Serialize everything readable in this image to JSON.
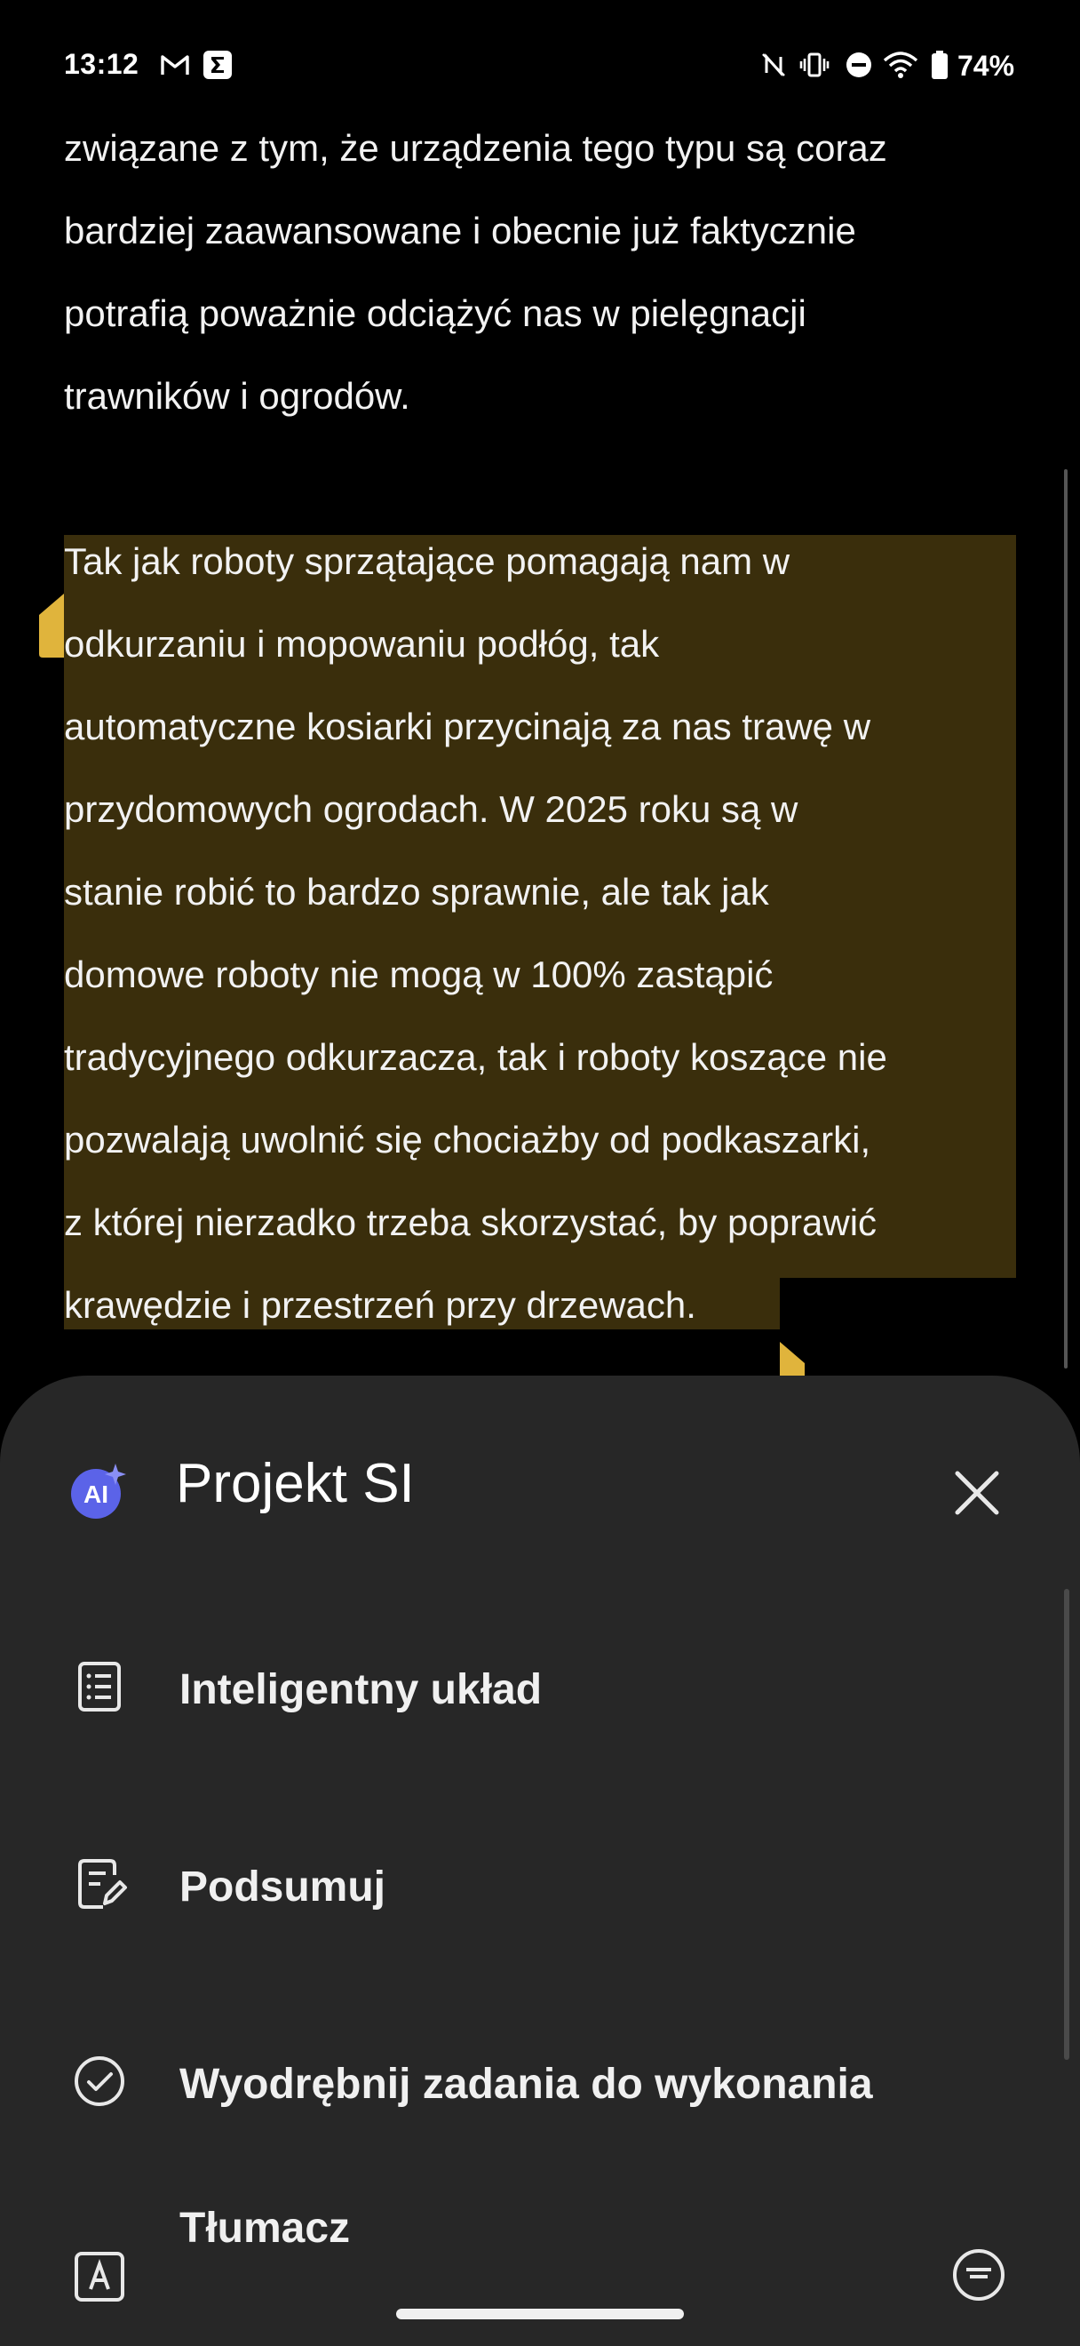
{
  "status": {
    "time": "13:12",
    "battery": "74%",
    "left_icons": [
      "gmail-icon",
      "sigma-app-icon"
    ],
    "right_icons": [
      "nfc-icon",
      "vibrate-icon",
      "do-not-disturb-icon",
      "wifi-icon",
      "battery-icon"
    ]
  },
  "article": {
    "para1": [
      "związane z tym, że urządzenia tego typu są coraz",
      "bardziej zaawansowane i obecnie już faktycznie",
      "potrafią poważnie odciążyć nas w pielęgnacji",
      "trawników i ogrodów."
    ],
    "para2": [
      "Tak jak roboty sprzątające pomagają nam w",
      "odkurzaniu i mopowaniu podłóg, tak",
      "automatyczne kosiarki przycinają za nas trawę w",
      "przydomowych ogrodach. W 2025 roku są w",
      "stanie robić to bardzo sprawnie, ale tak jak",
      "domowe roboty nie mogą w 100% zastąpić",
      "tradycyjnego odkurzacza, tak i roboty koszące nie",
      "pozwalają uwolnić się chociażby od podkaszarki,",
      "z której nierzadko trzeba skorzystać, by poprawić",
      "krawędzie i przestrzeń przy drzewach."
    ]
  },
  "sheet": {
    "logo_text": "AI",
    "title": "Projekt SI",
    "items": [
      {
        "label": "Inteligentny układ",
        "icon": "document-list-icon"
      },
      {
        "label": "Podsumuj",
        "icon": "document-edit-icon"
      },
      {
        "label": "Wyodrębnij zadania do wykonania",
        "icon": "check-circle-icon"
      },
      {
        "label": "Tłumacz",
        "icon": "translate-icon"
      }
    ]
  },
  "colors": {
    "background": "#000000",
    "selection": "#3a2e0c",
    "handle": "#e0b43c",
    "sheet": "#272727",
    "ai_logo": "#5b63e8"
  }
}
